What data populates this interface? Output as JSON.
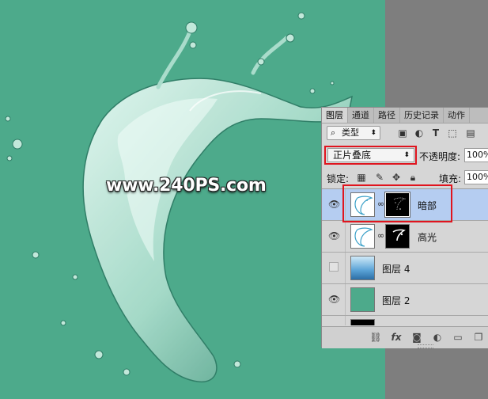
{
  "watermark": "www.240PS.com",
  "layers_panel": {
    "tabs": [
      {
        "label": "图层",
        "active": true
      },
      {
        "label": "通道",
        "active": false
      },
      {
        "label": "路径",
        "active": false
      },
      {
        "label": "历史记录",
        "active": false
      },
      {
        "label": "动作",
        "active": false
      }
    ],
    "filter": {
      "label": "类型",
      "icons": [
        "image-filter-icon",
        "adjustment-filter-icon",
        "type-filter-icon",
        "shape-filter-icon",
        "smart-object-filter-icon"
      ]
    },
    "blend_mode": "正片叠底",
    "opacity_label": "不透明度:",
    "opacity_value": "100%",
    "lock_label": "锁定:",
    "lock_icons": [
      "lock-transparent-icon",
      "lock-paint-icon",
      "lock-position-icon",
      "lock-all-icon"
    ],
    "fill_label": "填充:",
    "fill_value": "100%",
    "layers": [
      {
        "name": "暗部",
        "visible": true,
        "selected": true,
        "has_mask": true,
        "thumb": "splash"
      },
      {
        "name": "高光",
        "visible": true,
        "selected": false,
        "has_mask": true,
        "thumb": "splash"
      },
      {
        "name": "图层 4",
        "visible": false,
        "selected": false,
        "has_mask": false,
        "thumb": "sky"
      },
      {
        "name": "图层 2",
        "visible": true,
        "selected": false,
        "has_mask": false,
        "thumb": "green"
      }
    ],
    "bottom_icons": [
      "link-layers-icon",
      "fx-icon",
      "add-mask-icon",
      "adjustment-layer-icon",
      "group-folder-icon",
      "new-layer-icon"
    ]
  },
  "colors": {
    "canvas_bg": "#4daa8b",
    "pasteboard": "#7e7e7e",
    "selected_row": "#b5cdf1",
    "highlight_box": "#e0141e"
  }
}
